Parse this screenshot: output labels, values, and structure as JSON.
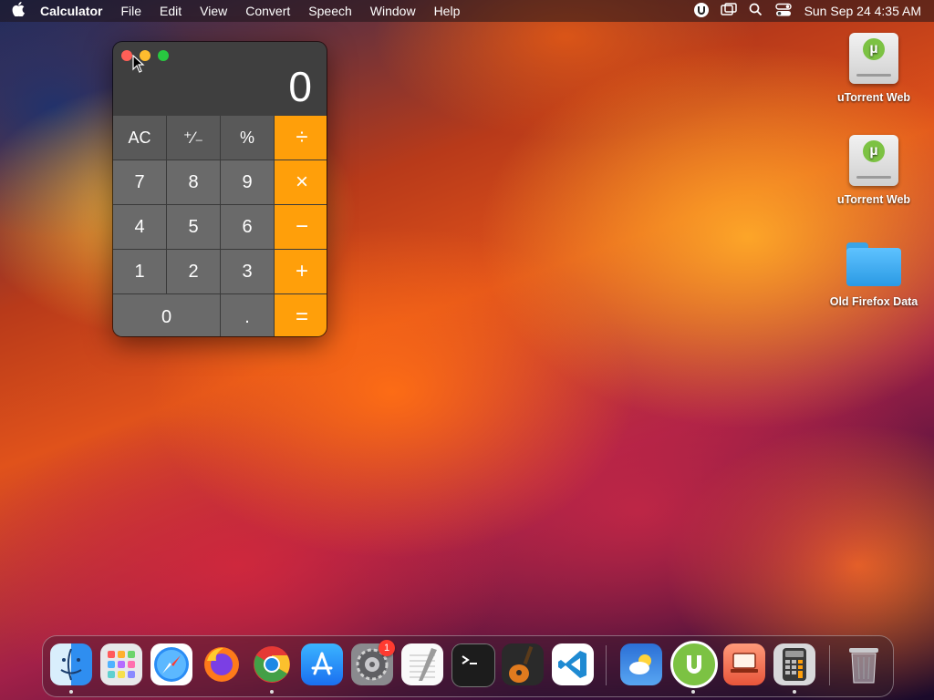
{
  "menubar": {
    "apple_icon": "apple-logo-icon",
    "app_name": "Calculator",
    "menus": [
      "File",
      "Edit",
      "View",
      "Convert",
      "Speech",
      "Window",
      "Help"
    ],
    "status_icons": [
      "utorrent-icon",
      "screen-mirroring-icon",
      "search-icon",
      "control-center-icon"
    ],
    "clock": "Sun Sep 24  4:35 AM"
  },
  "calculator": {
    "display": "0",
    "keys": {
      "ac": "AC",
      "sign": "⁺∕₋",
      "percent": "%",
      "divide": "÷",
      "seven": "7",
      "eight": "8",
      "nine": "9",
      "multiply": "×",
      "four": "4",
      "five": "5",
      "six": "6",
      "minus": "−",
      "one": "1",
      "two": "2",
      "three": "3",
      "plus": "+",
      "zero": "0",
      "decimal": ".",
      "equals": "="
    },
    "colors": {
      "operator": "#ff9f0a",
      "digit": "#6a6a6a",
      "function": "#595959"
    }
  },
  "desktop": {
    "icons": [
      {
        "label": "uTorrent Web",
        "icon": "utorrent-drive-icon"
      },
      {
        "label": "uTorrent Web",
        "icon": "utorrent-drive-icon"
      },
      {
        "label": "Old Firefox Data",
        "icon": "folder-icon"
      }
    ]
  },
  "dock": {
    "apps": [
      {
        "name": "Finder",
        "icon": "finder-icon",
        "running": true
      },
      {
        "name": "Launchpad",
        "icon": "launchpad-icon",
        "running": false
      },
      {
        "name": "Safari",
        "icon": "safari-icon",
        "running": false
      },
      {
        "name": "Firefox",
        "icon": "firefox-icon",
        "running": false
      },
      {
        "name": "Google Chrome",
        "icon": "chrome-icon",
        "running": true
      },
      {
        "name": "App Store",
        "icon": "app-store-icon",
        "running": false
      },
      {
        "name": "System Preferences",
        "icon": "settings-icon",
        "running": false,
        "badge": "1"
      },
      {
        "name": "TextEdit",
        "icon": "textedit-icon",
        "running": false
      },
      {
        "name": "Terminal",
        "icon": "terminal-icon",
        "running": false
      },
      {
        "name": "GarageBand",
        "icon": "garageband-icon",
        "running": false
      },
      {
        "name": "Visual Studio Code",
        "icon": "vscode-icon",
        "running": false
      },
      {
        "name": "Weather",
        "icon": "weather-icon",
        "running": false
      },
      {
        "name": "uTorrent Web",
        "icon": "utorrent-icon",
        "running": true
      },
      {
        "name": "Screen Sharing",
        "icon": "screen-sharing-icon",
        "running": false
      },
      {
        "name": "Calculator",
        "icon": "calculator-icon",
        "running": true
      },
      {
        "name": "Trash",
        "icon": "trash-icon",
        "running": false
      }
    ]
  }
}
